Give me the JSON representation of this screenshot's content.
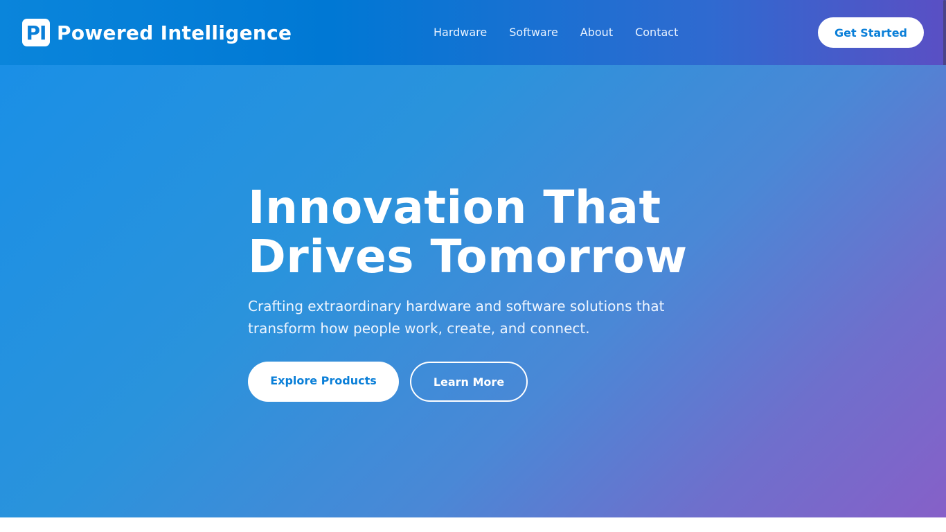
{
  "header": {
    "logo_mark": "PI",
    "brand": "Powered Intelligence",
    "nav": [
      "Hardware",
      "Software",
      "About",
      "Contact"
    ],
    "cta": "Get Started"
  },
  "hero": {
    "title_line1": "Innovation That",
    "title_line2": "Drives Tomorrow",
    "subtitle_line1": "Crafting extraordinary hardware and software solutions that",
    "subtitle_line2": "transform how people work, create, and connect.",
    "primary_button": "Explore Products",
    "secondary_button": "Learn More"
  },
  "colors": {
    "accent": "#0a7fd8",
    "header_start": "#0a85db",
    "header_end": "#5a4fc4",
    "hero_start": "#1a8fe6",
    "hero_end": "#8660c8"
  }
}
